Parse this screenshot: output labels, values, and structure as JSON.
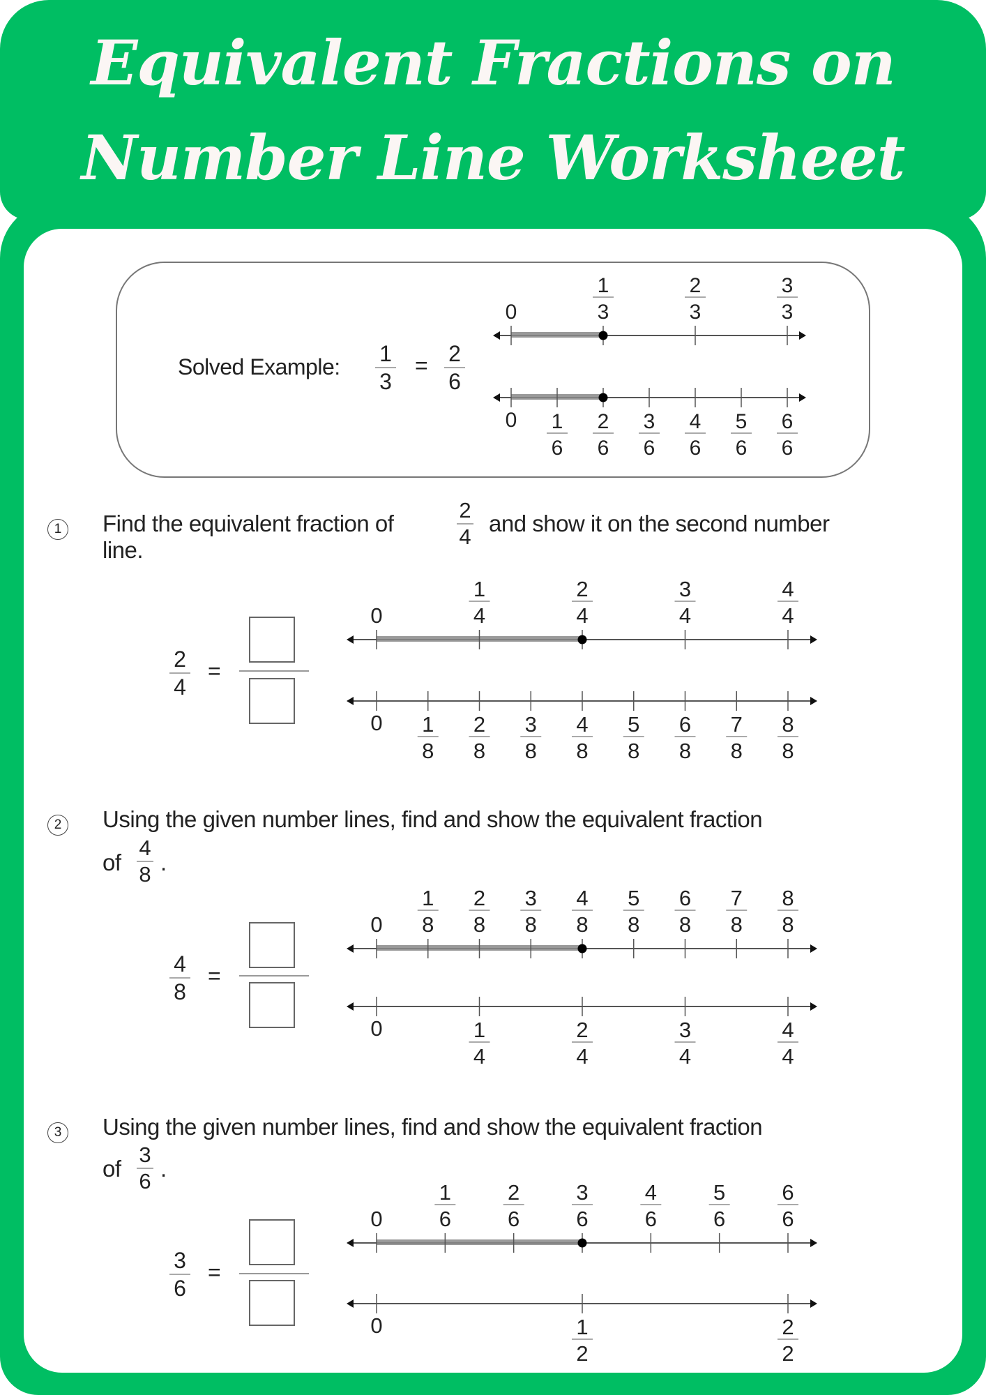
{
  "title": {
    "line1": "Equivalent Fractions on",
    "line2": "Number Line Worksheet"
  },
  "colors": {
    "brand_green": "#00BE63",
    "title_text": "#FBF6F4",
    "shade": "#888888"
  },
  "example": {
    "label": "Solved Example:",
    "lhs": {
      "num": "1",
      "den": "3"
    },
    "rhs": {
      "num": "2",
      "den": "6"
    },
    "equals": "=",
    "lines": [
      {
        "divisions": 3,
        "labels_position": "above",
        "shaded_to": 1,
        "point_at": 1,
        "zero": "0"
      },
      {
        "divisions": 6,
        "labels_position": "below",
        "shaded_to": 2,
        "point_at": 2,
        "zero": "0"
      }
    ]
  },
  "questions": [
    {
      "number": "1",
      "text_before": "Find the equivalent fraction of",
      "fraction": {
        "num": "2",
        "den": "4"
      },
      "text_after": "and show it on the second number",
      "text_line2": "line.",
      "lhs": {
        "num": "2",
        "den": "4"
      },
      "equals": "=",
      "answer_num": "",
      "answer_den": "",
      "lines": [
        {
          "divisions": 4,
          "labels_position": "above",
          "shaded_to": 2,
          "point_at": 2,
          "zero": "0"
        },
        {
          "divisions": 8,
          "labels_position": "below",
          "shaded_to": null,
          "point_at": null,
          "zero": "0"
        }
      ]
    },
    {
      "number": "2",
      "text_before": "Using the given number lines, find and show the equivalent fraction",
      "text_line2_prefix": "of",
      "fraction": {
        "num": "4",
        "den": "8"
      },
      "text_line2_suffix": ".",
      "lhs": {
        "num": "4",
        "den": "8"
      },
      "equals": "=",
      "answer_num": "",
      "answer_den": "",
      "lines": [
        {
          "divisions": 8,
          "labels_position": "above",
          "shaded_to": 4,
          "point_at": 4,
          "zero": "0"
        },
        {
          "divisions": 4,
          "labels_position": "below",
          "shaded_to": null,
          "point_at": null,
          "zero": "0"
        }
      ]
    },
    {
      "number": "3",
      "text_before": "Using the given number lines, find and show the equivalent fraction",
      "text_line2_prefix": "of",
      "fraction": {
        "num": "3",
        "den": "6"
      },
      "text_line2_suffix": ".",
      "lhs": {
        "num": "3",
        "den": "6"
      },
      "equals": "=",
      "answer_num": "",
      "answer_den": "",
      "lines": [
        {
          "divisions": 6,
          "labels_position": "above",
          "shaded_to": 3,
          "point_at": 3,
          "zero": "0"
        },
        {
          "divisions": 2,
          "labels_position": "below",
          "shaded_to": null,
          "point_at": null,
          "zero": "0"
        }
      ]
    }
  ]
}
